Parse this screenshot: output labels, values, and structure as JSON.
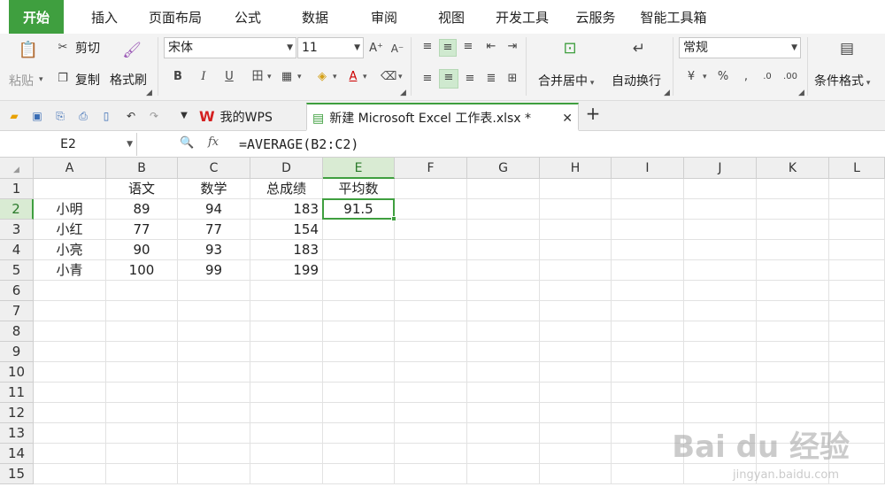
{
  "menu": {
    "tabs": [
      "开始",
      "插入",
      "页面布局",
      "公式",
      "数据",
      "审阅",
      "视图",
      "开发工具",
      "云服务",
      "智能工具箱"
    ]
  },
  "ribbon": {
    "paste": "粘贴",
    "cut": "剪切",
    "copy": "复制",
    "format_painter": "格式刷",
    "font_name": "宋体",
    "font_size": "11",
    "bold": "B",
    "italic": "I",
    "underline": "U",
    "merge_center": "合并居中",
    "wrap_text": "自动换行",
    "number_format": "常规",
    "percent": "%",
    "comma": ",",
    "conditional_format": "条件格式"
  },
  "doc_tabs": {
    "my_wps": "我的WPS",
    "file": "新建 Microsoft Excel 工作表.xlsx *"
  },
  "formula_bar": {
    "name_box": "E2",
    "fx": "fx",
    "formula": "=AVERAGE(B2:C2)"
  },
  "sheet": {
    "columns": [
      "A",
      "B",
      "C",
      "D",
      "E",
      "F",
      "G",
      "H",
      "I",
      "J",
      "K",
      "L"
    ],
    "rows": [
      "1",
      "2",
      "3",
      "4",
      "5",
      "6",
      "7",
      "8",
      "9",
      "10",
      "11",
      "12",
      "13",
      "14",
      "15"
    ],
    "header_row": [
      "",
      "语文",
      "数学",
      "总成绩",
      "平均数"
    ],
    "data": [
      [
        "小明",
        "89",
        "94",
        "183",
        "91.5"
      ],
      [
        "小红",
        "77",
        "77",
        "154",
        ""
      ],
      [
        "小亮",
        "90",
        "93",
        "183",
        ""
      ],
      [
        "小青",
        "100",
        "99",
        "199",
        ""
      ]
    ]
  },
  "watermark": {
    "brand": "Bai du 经验",
    "url": "jingyan.baidu.com"
  },
  "colors": {
    "accent": "#3f9f3f",
    "selected_header": "#d9ebd3"
  }
}
